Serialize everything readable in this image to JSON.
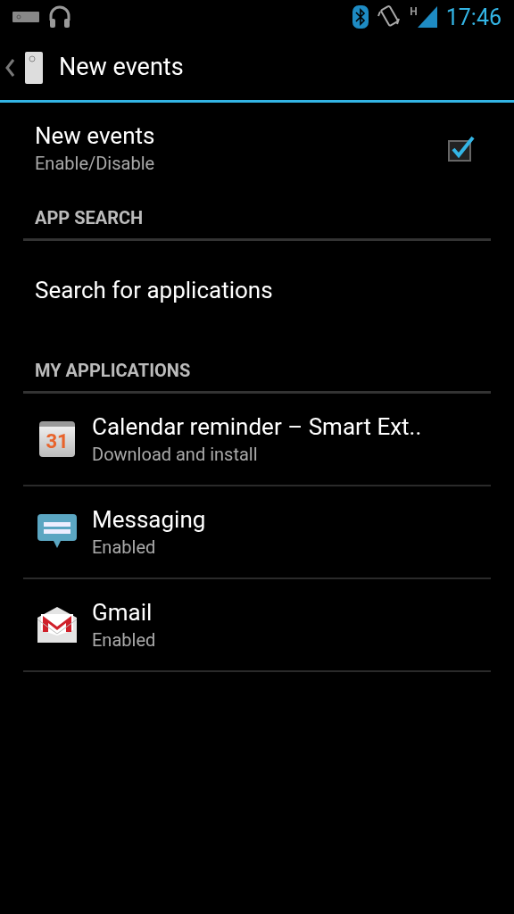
{
  "status_bar": {
    "time": "17:46",
    "network": "H"
  },
  "action_bar": {
    "title": "New events"
  },
  "toggle": {
    "title": "New events",
    "summary": "Enable/Disable",
    "checked": true
  },
  "sections": [
    {
      "header": "APP SEARCH",
      "items": [
        {
          "kind": "plain",
          "title": "Search for applications"
        }
      ]
    },
    {
      "header": "MY APPLICATIONS",
      "items": [
        {
          "kind": "calendar",
          "icon_text": "31",
          "title": "Calendar reminder – Smart Ext..",
          "summary": "Download and install"
        },
        {
          "kind": "messaging",
          "title": "Messaging",
          "summary": "Enabled"
        },
        {
          "kind": "mail",
          "title": "Gmail",
          "summary": "Enabled"
        }
      ]
    }
  ]
}
